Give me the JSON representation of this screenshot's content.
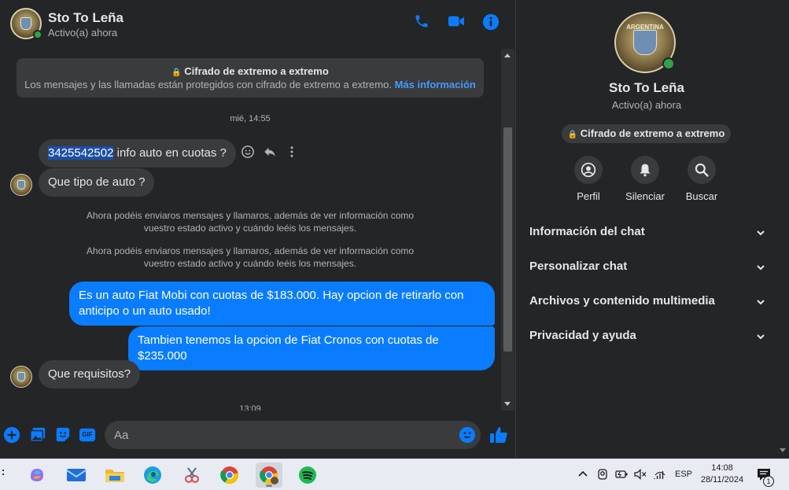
{
  "header": {
    "name": "Sto To Leña",
    "status": "Activo(a) ahora"
  },
  "encryption": {
    "title": "Cifrado de extremo a extremo",
    "description": "Los mensajes y las llamadas están protegidos con cifrado de extremo a extremo.",
    "link": "Más información"
  },
  "messages": {
    "timestamp_1": "mié, 14:55",
    "m1_phone": "3425542502",
    "m1_rest": " info auto en cuotas ?",
    "m2": "Que tipo de auto ?",
    "sys1_line1": "Ahora podéis enviaros mensajes y llamaros, además de ver información como",
    "sys1_line2": "vuestro estado activo y cuándo leéis los mensajes.",
    "sys2_line1": "Ahora podéis enviaros mensajes y llamaros, además de ver información como",
    "sys2_line2": "vuestro estado activo y cuándo leéis los mensajes.",
    "m3_line1": "Es un auto Fiat Mobi con cuotas de $183.000. Hay opcion de retirarlo con",
    "m3_line2": "anticipo o un auto usado!",
    "m4": "Tambien tenemos la opcion de Fiat Cronos con cuotas de $235.000",
    "m5": "Que  requisitos?",
    "timestamp_2": "13:09"
  },
  "composer": {
    "placeholder": "Aa",
    "gif_label": "GIF"
  },
  "info_panel": {
    "name": "Sto To Leña",
    "status": "Activo(a) ahora",
    "e2e_pill": "Cifrado de extremo a extremo",
    "avatar_text": "ARGENTINA",
    "actions": {
      "profile": "Perfil",
      "mute": "Silenciar",
      "search": "Buscar"
    },
    "sections": [
      "Información del chat",
      "Personalizar chat",
      "Archivos y contenido multimedia",
      "Privacidad y ayuda"
    ]
  },
  "taskbar": {
    "language": "ESP",
    "time": "14:08",
    "date": "28/11/2024",
    "notification_count": "1"
  },
  "colors": {
    "accent": "#0a7cff",
    "background": "#242526",
    "bubble_in": "#3a3b3c",
    "online": "#31a24c"
  }
}
